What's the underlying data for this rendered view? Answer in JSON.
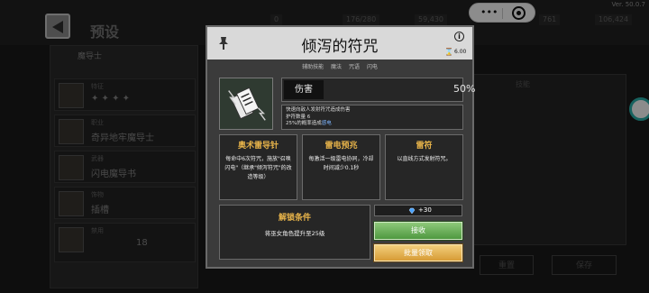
{
  "background": {
    "page_title": "预设",
    "version": "Ver. 50.0.7",
    "resources": [
      "0",
      "176/280",
      "59,430",
      "761",
      "106,424"
    ],
    "hero": {
      "name": "魔导士"
    },
    "slots": [
      {
        "category": "特征",
        "value": "✦ ✦ ✦ ✦"
      },
      {
        "category": "职业",
        "value": "奇异地牢魔导士"
      },
      {
        "category": "武器",
        "value": "闪电魔导书"
      },
      {
        "category": "饰物",
        "value": "插槽"
      },
      {
        "category": "禁用",
        "value": "18"
      }
    ],
    "skill_tab": "技能",
    "bottom_buttons": [
      "重置",
      "保存"
    ]
  },
  "modal": {
    "title": "倾泻的符咒",
    "cooldown": "6.00",
    "tags": [
      "辅助技能",
      "魔法",
      "咒语",
      "闪电"
    ],
    "damage_label": "伤害",
    "damage_value": "50%",
    "desc_lines": [
      "快速向敌人发射符咒造成伤害",
      "护符数量 6"
    ],
    "desc_prefix": "25%的概率造成",
    "desc_link": "感电",
    "modifiers": [
      {
        "title": "奥术雷导针",
        "desc": "每命中6次符咒，施放\"召唤闪电\"（继承\"倾泻符咒\"的改造等级）"
      },
      {
        "title": "雷电预兆",
        "desc": "每激活一级雷电协同，冷却时间减少0.1秒"
      },
      {
        "title": "雷符",
        "desc": "以直线方式发射符咒。"
      }
    ],
    "unlock_title": "解锁条件",
    "unlock_condition": "将巫女角色提升至25级",
    "reward_amount": "+30",
    "claim_label": "接收",
    "batch_label": "批量领取"
  },
  "colors": {
    "accent_gold": "#e8b44a",
    "claim_green": "#5fae4e",
    "batch_gold": "#e3ad4d",
    "link_blue": "#7fb6ff"
  }
}
